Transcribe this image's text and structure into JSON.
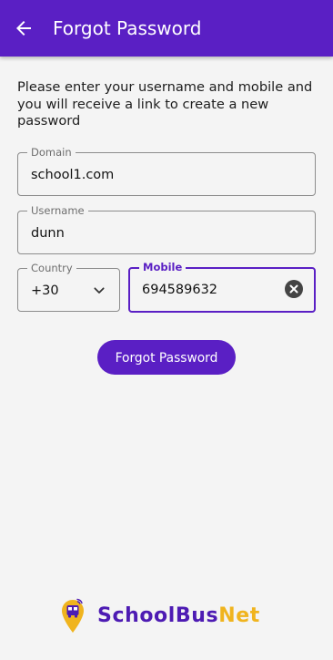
{
  "appbar": {
    "title": "Forgot Password",
    "back_icon": "arrow-left-icon"
  },
  "intro_text": "Please enter your username and mobile and you will receive a link to create a new password",
  "form": {
    "domain": {
      "label": "Domain",
      "value": "school1.com"
    },
    "username": {
      "label": "Username",
      "value": "dunn"
    },
    "country": {
      "label": "Country",
      "value": "+30",
      "icon": "chevron-down-icon"
    },
    "mobile": {
      "label": "Mobile",
      "value": "694589632",
      "clear_icon": "clear-circle-icon"
    }
  },
  "submit_label": "Forgot Password",
  "brand": {
    "part1": "SchoolBus",
    "part2": "Net",
    "logo_icon": "school-bus-pin-icon"
  },
  "colors": {
    "primary": "#5a1fc4",
    "accent": "#f0b41e",
    "background": "#f4f4f4"
  }
}
